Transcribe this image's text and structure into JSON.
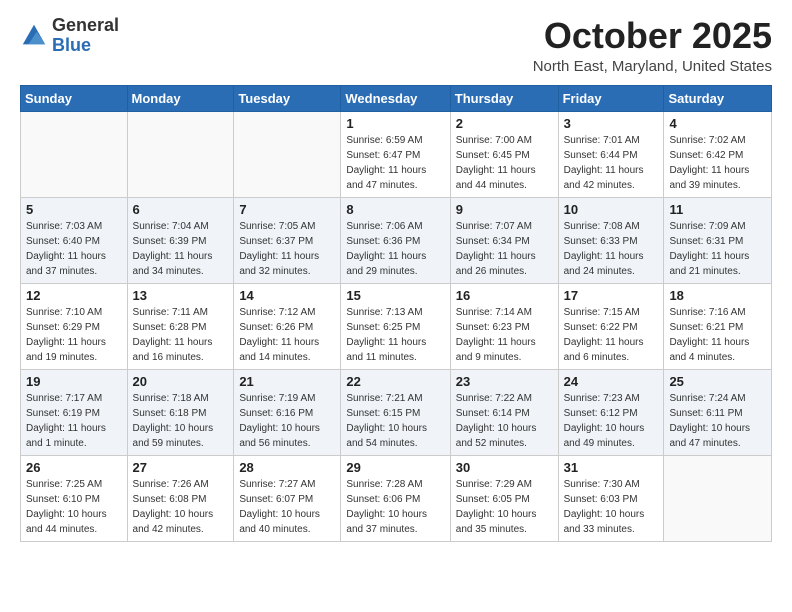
{
  "header": {
    "logo_general": "General",
    "logo_blue": "Blue",
    "month": "October 2025",
    "location": "North East, Maryland, United States"
  },
  "days_of_week": [
    "Sunday",
    "Monday",
    "Tuesday",
    "Wednesday",
    "Thursday",
    "Friday",
    "Saturday"
  ],
  "weeks": [
    [
      {
        "day": "",
        "info": ""
      },
      {
        "day": "",
        "info": ""
      },
      {
        "day": "",
        "info": ""
      },
      {
        "day": "1",
        "info": "Sunrise: 6:59 AM\nSunset: 6:47 PM\nDaylight: 11 hours and 47 minutes."
      },
      {
        "day": "2",
        "info": "Sunrise: 7:00 AM\nSunset: 6:45 PM\nDaylight: 11 hours and 44 minutes."
      },
      {
        "day": "3",
        "info": "Sunrise: 7:01 AM\nSunset: 6:44 PM\nDaylight: 11 hours and 42 minutes."
      },
      {
        "day": "4",
        "info": "Sunrise: 7:02 AM\nSunset: 6:42 PM\nDaylight: 11 hours and 39 minutes."
      }
    ],
    [
      {
        "day": "5",
        "info": "Sunrise: 7:03 AM\nSunset: 6:40 PM\nDaylight: 11 hours and 37 minutes."
      },
      {
        "day": "6",
        "info": "Sunrise: 7:04 AM\nSunset: 6:39 PM\nDaylight: 11 hours and 34 minutes."
      },
      {
        "day": "7",
        "info": "Sunrise: 7:05 AM\nSunset: 6:37 PM\nDaylight: 11 hours and 32 minutes."
      },
      {
        "day": "8",
        "info": "Sunrise: 7:06 AM\nSunset: 6:36 PM\nDaylight: 11 hours and 29 minutes."
      },
      {
        "day": "9",
        "info": "Sunrise: 7:07 AM\nSunset: 6:34 PM\nDaylight: 11 hours and 26 minutes."
      },
      {
        "day": "10",
        "info": "Sunrise: 7:08 AM\nSunset: 6:33 PM\nDaylight: 11 hours and 24 minutes."
      },
      {
        "day": "11",
        "info": "Sunrise: 7:09 AM\nSunset: 6:31 PM\nDaylight: 11 hours and 21 minutes."
      }
    ],
    [
      {
        "day": "12",
        "info": "Sunrise: 7:10 AM\nSunset: 6:29 PM\nDaylight: 11 hours and 19 minutes."
      },
      {
        "day": "13",
        "info": "Sunrise: 7:11 AM\nSunset: 6:28 PM\nDaylight: 11 hours and 16 minutes."
      },
      {
        "day": "14",
        "info": "Sunrise: 7:12 AM\nSunset: 6:26 PM\nDaylight: 11 hours and 14 minutes."
      },
      {
        "day": "15",
        "info": "Sunrise: 7:13 AM\nSunset: 6:25 PM\nDaylight: 11 hours and 11 minutes."
      },
      {
        "day": "16",
        "info": "Sunrise: 7:14 AM\nSunset: 6:23 PM\nDaylight: 11 hours and 9 minutes."
      },
      {
        "day": "17",
        "info": "Sunrise: 7:15 AM\nSunset: 6:22 PM\nDaylight: 11 hours and 6 minutes."
      },
      {
        "day": "18",
        "info": "Sunrise: 7:16 AM\nSunset: 6:21 PM\nDaylight: 11 hours and 4 minutes."
      }
    ],
    [
      {
        "day": "19",
        "info": "Sunrise: 7:17 AM\nSunset: 6:19 PM\nDaylight: 11 hours and 1 minute."
      },
      {
        "day": "20",
        "info": "Sunrise: 7:18 AM\nSunset: 6:18 PM\nDaylight: 10 hours and 59 minutes."
      },
      {
        "day": "21",
        "info": "Sunrise: 7:19 AM\nSunset: 6:16 PM\nDaylight: 10 hours and 56 minutes."
      },
      {
        "day": "22",
        "info": "Sunrise: 7:21 AM\nSunset: 6:15 PM\nDaylight: 10 hours and 54 minutes."
      },
      {
        "day": "23",
        "info": "Sunrise: 7:22 AM\nSunset: 6:14 PM\nDaylight: 10 hours and 52 minutes."
      },
      {
        "day": "24",
        "info": "Sunrise: 7:23 AM\nSunset: 6:12 PM\nDaylight: 10 hours and 49 minutes."
      },
      {
        "day": "25",
        "info": "Sunrise: 7:24 AM\nSunset: 6:11 PM\nDaylight: 10 hours and 47 minutes."
      }
    ],
    [
      {
        "day": "26",
        "info": "Sunrise: 7:25 AM\nSunset: 6:10 PM\nDaylight: 10 hours and 44 minutes."
      },
      {
        "day": "27",
        "info": "Sunrise: 7:26 AM\nSunset: 6:08 PM\nDaylight: 10 hours and 42 minutes."
      },
      {
        "day": "28",
        "info": "Sunrise: 7:27 AM\nSunset: 6:07 PM\nDaylight: 10 hours and 40 minutes."
      },
      {
        "day": "29",
        "info": "Sunrise: 7:28 AM\nSunset: 6:06 PM\nDaylight: 10 hours and 37 minutes."
      },
      {
        "day": "30",
        "info": "Sunrise: 7:29 AM\nSunset: 6:05 PM\nDaylight: 10 hours and 35 minutes."
      },
      {
        "day": "31",
        "info": "Sunrise: 7:30 AM\nSunset: 6:03 PM\nDaylight: 10 hours and 33 minutes."
      },
      {
        "day": "",
        "info": ""
      }
    ]
  ]
}
